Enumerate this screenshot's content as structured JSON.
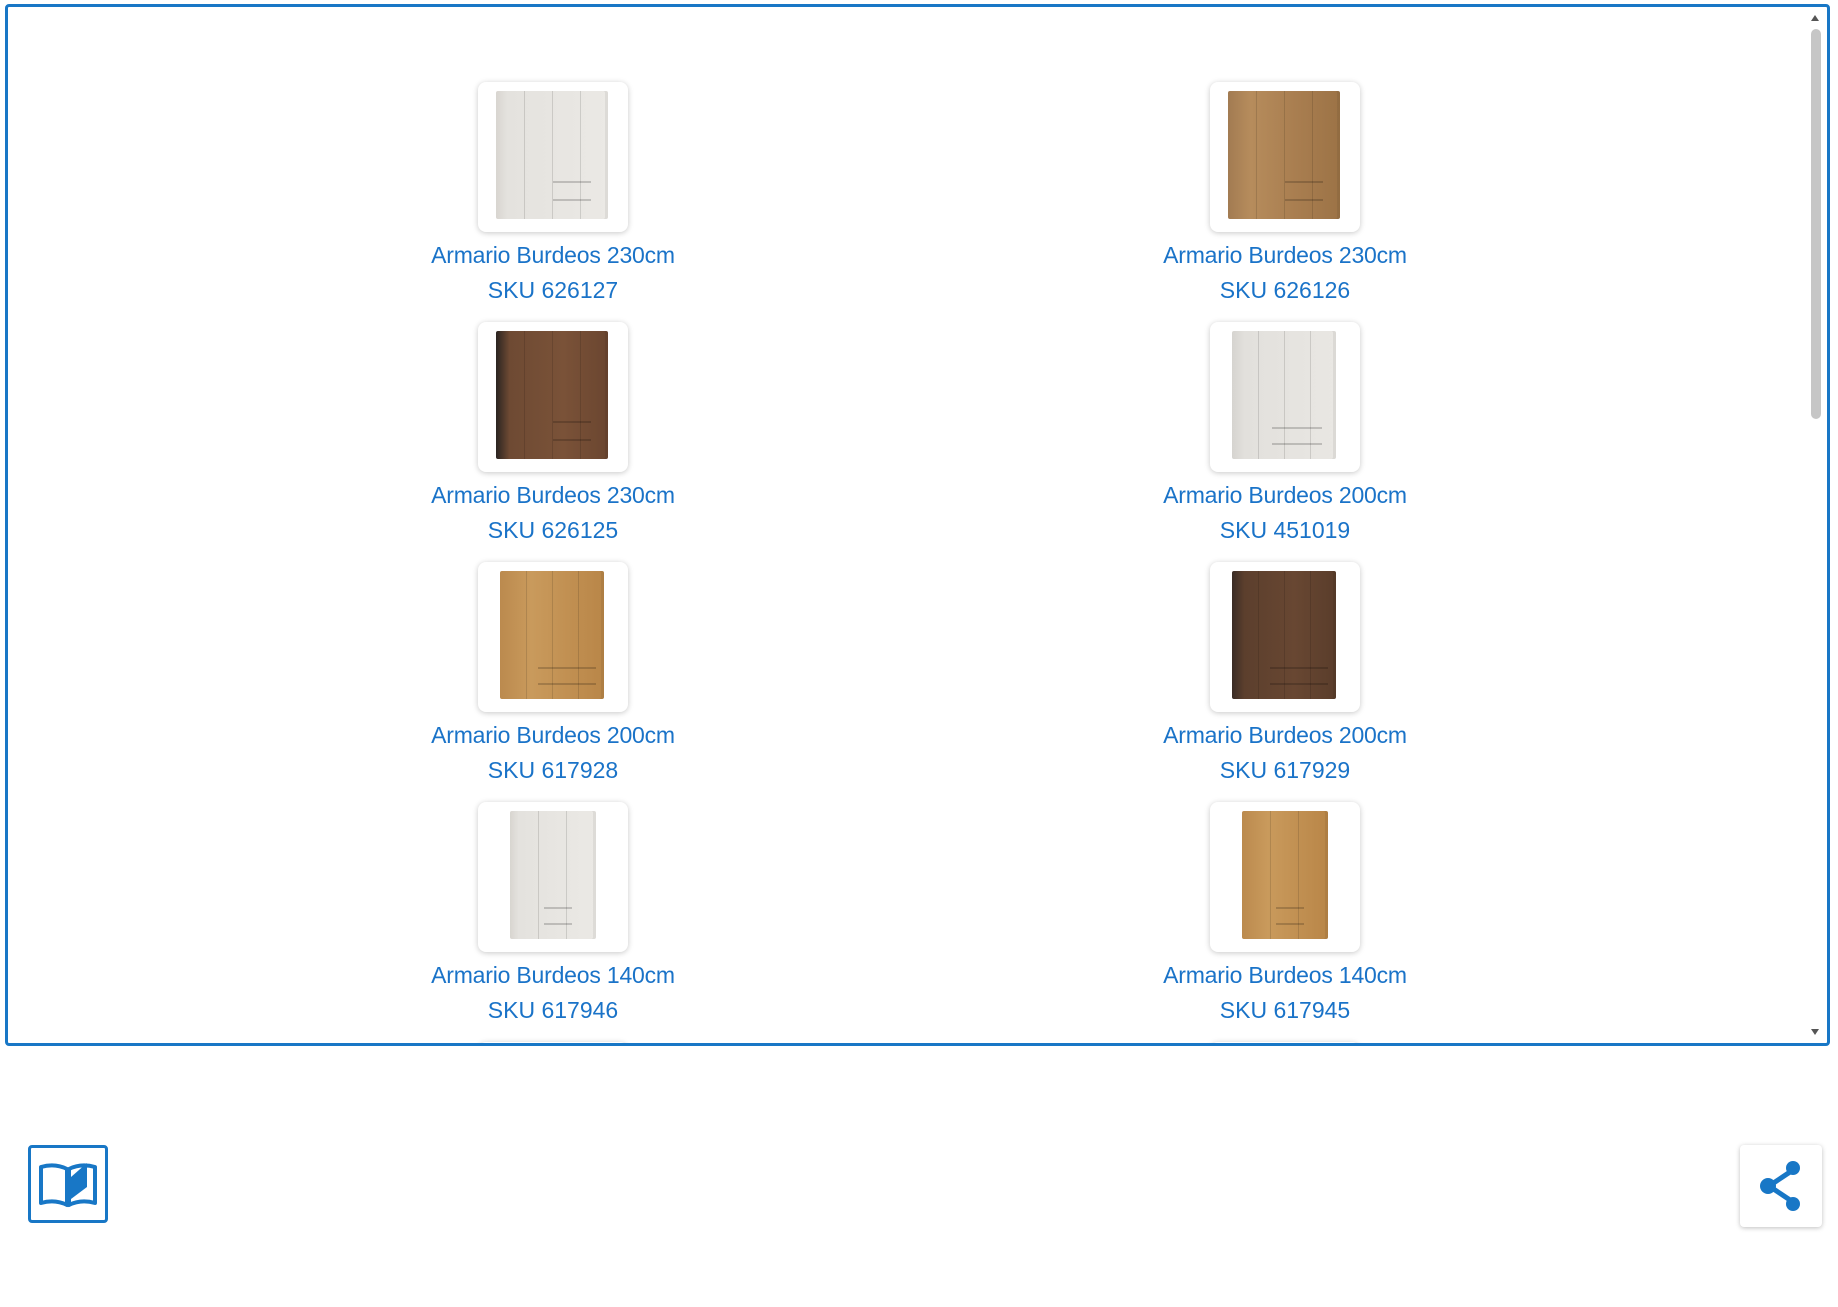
{
  "products": [
    {
      "title": "Armario Burdeos 230cm",
      "sku": "SKU 626127",
      "finish": "white"
    },
    {
      "title": "Armario Burdeos 230cm",
      "sku": "SKU 626126",
      "finish": "oak"
    },
    {
      "title": "Armario Burdeos 230cm",
      "sku": "SKU 626125",
      "finish": "walnut"
    },
    {
      "title": "Armario Burdeos 200cm",
      "sku": "SKU 451019",
      "finish": "white"
    },
    {
      "title": "Armario Burdeos 200cm",
      "sku": "SKU 617928",
      "finish": "oak"
    },
    {
      "title": "Armario Burdeos 200cm",
      "sku": "SKU 617929",
      "finish": "walnut"
    },
    {
      "title": "Armario Burdeos 140cm",
      "sku": "SKU 617946",
      "finish": "white"
    },
    {
      "title": "Armario Burdeos 140cm",
      "sku": "SKU 617945",
      "finish": "oak"
    }
  ],
  "colors": {
    "accent": "#1877c6",
    "link": "#1a73c8"
  },
  "icons": {
    "catalog": "book-open-icon",
    "share": "share-icon"
  }
}
